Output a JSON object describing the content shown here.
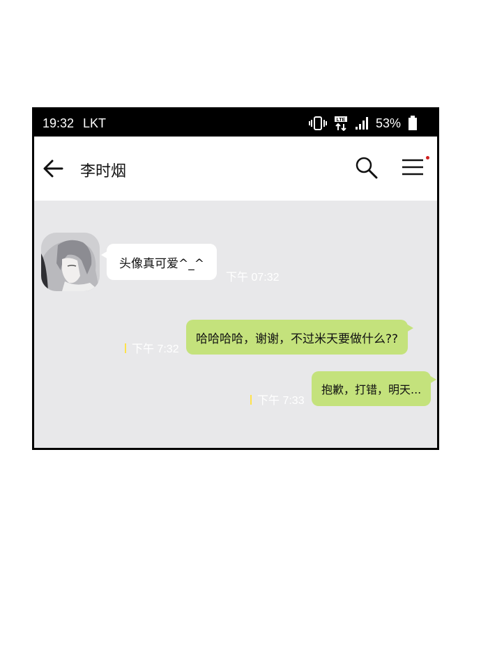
{
  "status_bar": {
    "time": "19:32",
    "carrier": "LKT",
    "network": "LTE",
    "battery": "53%",
    "icons": [
      "vibrate-icon",
      "lte-icon",
      "signal-icon",
      "battery-icon"
    ]
  },
  "header": {
    "title": "李时烟",
    "back_icon": "back-arrow-icon",
    "search_icon": "search-icon",
    "menu_icon": "menu-icon"
  },
  "messages": [
    {
      "direction": "incoming",
      "text": "头像真可爱^_^",
      "time": "下午 07:32"
    },
    {
      "direction": "outgoing",
      "text": "哈哈哈哈，谢谢，不过米天要做什么??",
      "time": "下午 7:32"
    },
    {
      "direction": "outgoing",
      "text": "抱歉，打错，明天...",
      "time": "下午 7:33"
    }
  ],
  "colors": {
    "chat_background": "#e8e8ea",
    "outgoing_bubble": "#c4e27c",
    "incoming_bubble": "#ffffff",
    "read_mark": "#ffe24a",
    "notification_dot": "#d02020"
  }
}
